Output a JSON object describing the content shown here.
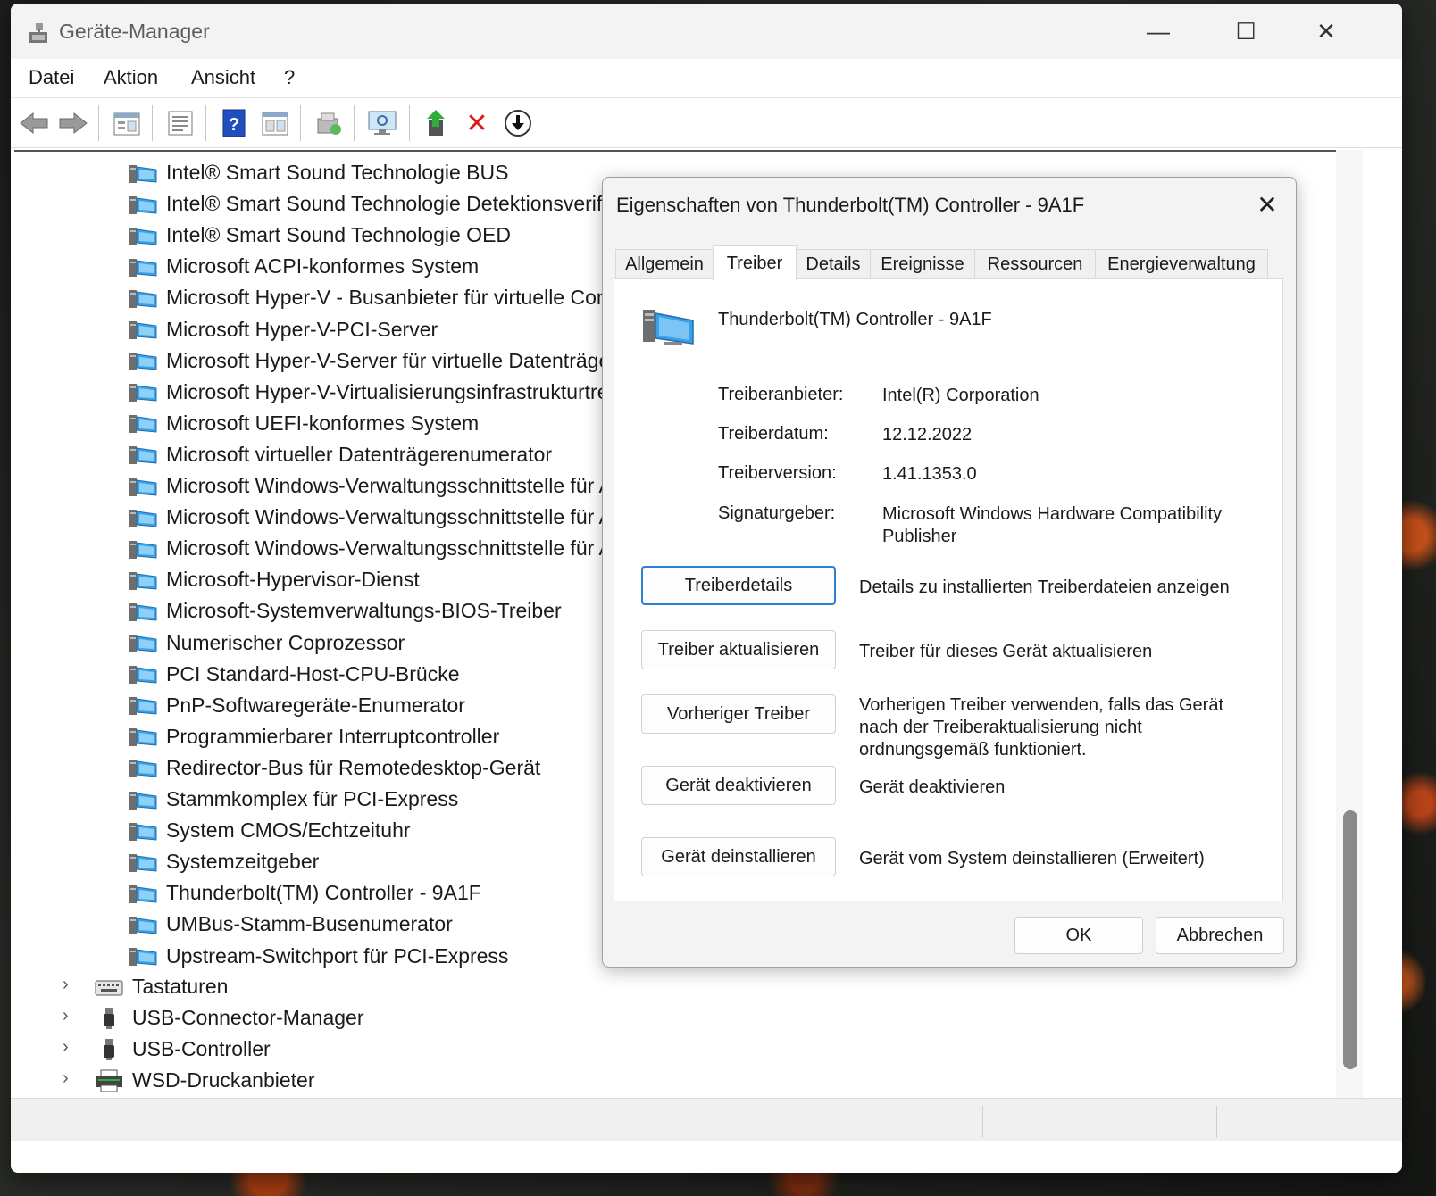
{
  "window": {
    "title": "Geräte-Manager",
    "caption_minimize": "—",
    "caption_maximize": "☐",
    "caption_close": "✕"
  },
  "menu": [
    "Datei",
    "Aktion",
    "Ansicht",
    "?"
  ],
  "toolbar": {
    "icons": [
      "back-icon",
      "forward-icon",
      "properties-icon",
      "list-icon",
      "help-icon",
      "view-icon",
      "scan-icon",
      "monitor-icon",
      "update-driver-icon",
      "uninstall-icon",
      "disable-icon"
    ],
    "uninstall_glyph": "✕",
    "disable_glyph": "⬇"
  },
  "tree": {
    "children": [
      "Intel® Smart Sound Technologie BUS",
      "Intel® Smart Sound Technologie Detektionsverifizierung",
      "Intel® Smart Sound Technologie OED",
      "Microsoft ACPI-konformes System",
      "Microsoft Hyper-V - Busanbieter für virtuelle Computer",
      "Microsoft Hyper-V-PCI-Server",
      "Microsoft Hyper-V-Server für virtuelle Datenträger",
      "Microsoft Hyper-V-Virtualisierungsinfrastrukturtreiber",
      "Microsoft UEFI-konformes System",
      "Microsoft virtueller Datenträgerenumerator",
      "Microsoft Windows-Verwaltungsschnittstelle für ACPI",
      "Microsoft Windows-Verwaltungsschnittstelle für ACPI",
      "Microsoft Windows-Verwaltungsschnittstelle für ACPI",
      "Microsoft-Hypervisor-Dienst",
      "Microsoft-Systemverwaltungs-BIOS-Treiber",
      "Numerischer Coprozessor",
      "PCI Standard-Host-CPU-Brücke",
      "PnP-Softwaregeräte-Enumerator",
      "Programmierbarer Interruptcontroller",
      "Redirector-Bus für Remotedesktop-Gerät",
      "Stammkomplex für PCI-Express",
      "System CMOS/Echtzeituhr",
      "Systemzeitgeber",
      "Thunderbolt(TM) Controller - 9A1F",
      "UMBus-Stamm-Busenumerator",
      "Upstream-Switchport für PCI-Express"
    ],
    "categories": [
      {
        "label": "Tastaturen",
        "icon": "keyboard-icon"
      },
      {
        "label": "USB-Connector-Manager",
        "icon": "usb-icon"
      },
      {
        "label": "USB-Controller",
        "icon": "usb-icon"
      },
      {
        "label": "WSD-Druckanbieter",
        "icon": "printer-icon"
      }
    ],
    "expand_glyph": "›"
  },
  "dialog": {
    "title": "Eigenschaften von Thunderbolt(TM) Controller - 9A1F",
    "close_glyph": "✕",
    "tabs": [
      "Allgemein",
      "Treiber",
      "Details",
      "Ereignisse",
      "Ressourcen",
      "Energieverwaltung"
    ],
    "active_tab": "Treiber",
    "device_name": "Thunderbolt(TM) Controller - 9A1F",
    "fields": [
      {
        "label": "Treiberanbieter:",
        "value": "Intel(R) Corporation"
      },
      {
        "label": "Treiberdatum:",
        "value": "12.12.2022"
      },
      {
        "label": "Treiberversion:",
        "value": "1.41.1353.0"
      },
      {
        "label": "Signaturgeber:",
        "value": "Microsoft Windows Hardware Compatibility Publisher"
      }
    ],
    "actions": [
      {
        "button": "Treiberdetails",
        "description": "Details zu installierten Treiberdateien anzeigen"
      },
      {
        "button": "Treiber aktualisieren",
        "description": "Treiber für dieses Gerät aktualisieren"
      },
      {
        "button": "Vorheriger Treiber",
        "description": "Vorherigen Treiber verwenden, falls das Gerät nach der Treiberaktualisierung nicht ordnungsgemäß funktioniert."
      },
      {
        "button": "Gerät deaktivieren",
        "description": "Gerät deaktivieren"
      },
      {
        "button": "Gerät deinstallieren",
        "description": "Gerät vom System deinstallieren (Erweitert)"
      }
    ],
    "ok": "OK",
    "cancel": "Abbrechen"
  },
  "colors": {
    "accent": "#2f7fd1",
    "device_icon_blue": "#3aa0e8",
    "uninstall_red": "#e01a1a",
    "help_blue": "#1f4fbf"
  }
}
